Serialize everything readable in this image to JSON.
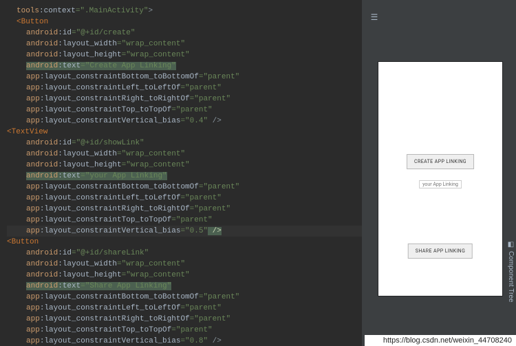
{
  "code": {
    "tools_context_prefix": "tools",
    "tools_context_attr": ":context",
    "tools_context_val": "=\".MainActivity\"",
    "tools_context_close": ">",
    "button_open": "<Button",
    "textview_open": "<TextView",
    "a_id": "android",
    "colon_id": ":id",
    "eq_id_create": "=\"@+id/create\"",
    "eq_id_showlink": "=\"@+id/showLink\"",
    "eq_id_sharelink": "=\"@+id/shareLink\"",
    "a_layout_width": "android",
    "colon_layout_width": ":layout_width",
    "eq_wrap": "=\"wrap_content\"",
    "a_layout_height": "android",
    "colon_layout_height": ":layout_height",
    "a_text": "android",
    "colon_text": ":text",
    "eq_text_create": "=\"Create App Linking\"",
    "eq_text_yourapp": "=\"your App Linking\"",
    "eq_text_share": "=\"Share App Linking\"",
    "app_ns": "app",
    "colon_cb": ":layout_constraintBottom_toBottomOf",
    "colon_cl": ":layout_constraintLeft_toLeftOf",
    "colon_cr": ":layout_constraintRight_toRightOf",
    "colon_ct": ":layout_constraintTop_toTopOf",
    "colon_cv": ":layout_constraintVertical_bias",
    "eq_parent": "=\"parent\"",
    "eq_bias04": "=\"0.4\"",
    "eq_bias05": "=\"0.5\"",
    "eq_bias08": "=\"0.8\"",
    "self_close": " />"
  },
  "preview": {
    "btn_create": "CREATE APP LINKING",
    "tv": "your App Linking",
    "btn_share": "SHARE APP LINKING"
  },
  "side": {
    "component_tree": "Component Tree"
  },
  "footer": {
    "url": "https://blog.csdn.net/weixin_44708240"
  },
  "toolbar": {
    "icon_preview": "☰"
  }
}
